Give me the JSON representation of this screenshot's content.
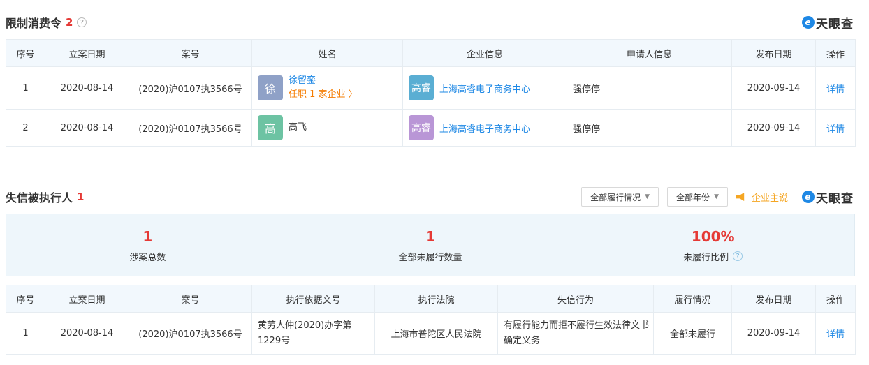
{
  "section1": {
    "title": "限制消费令",
    "count": "2",
    "help_icon": "?",
    "brand": "天眼查",
    "headers": [
      "序号",
      "立案日期",
      "案号",
      "姓名",
      "企业信息",
      "申请人信息",
      "发布日期",
      "操作"
    ],
    "rows": [
      {
        "index": "1",
        "filing_date": "2020-08-14",
        "case_no": "(2020)沪0107执3566号",
        "avatar_char": "徐",
        "avatar_color": "#8fa1c7",
        "name": "徐留銮",
        "role": "任职 1 家企业 〉",
        "company_avatar": "高睿",
        "company_avatar_color": "#5aaed3",
        "company": "上海高睿电子商务中心",
        "applicant": "强停停",
        "publish_date": "2020-09-14",
        "action": "详情"
      },
      {
        "index": "2",
        "filing_date": "2020-08-14",
        "case_no": "(2020)沪0107执3566号",
        "avatar_char": "高",
        "avatar_color": "#6dc3a3",
        "name": "高飞",
        "company_avatar": "高睿",
        "company_avatar_color": "#b996d6",
        "company": "上海高睿电子商务中心",
        "applicant": "强停停",
        "publish_date": "2020-09-14",
        "action": "详情"
      }
    ]
  },
  "section2": {
    "title": "失信被执行人",
    "count": "1",
    "filter_status": "全部履行情况",
    "filter_year": "全部年份",
    "self_say": "企业主说",
    "brand": "天眼查",
    "stats": [
      {
        "value": "1",
        "label": "涉案总数"
      },
      {
        "value": "1",
        "label": "全部未履行数量"
      },
      {
        "value": "100%",
        "label": "未履行比例"
      }
    ],
    "headers": [
      "序号",
      "立案日期",
      "案号",
      "执行依据文号",
      "执行法院",
      "失信行为",
      "履行情况",
      "发布日期",
      "操作"
    ],
    "rows": [
      {
        "index": "1",
        "filing_date": "2020-08-14",
        "case_no": "(2020)沪0107执3566号",
        "basis_no": "黄劳人仲(2020)办字第1229号",
        "court": "上海市普陀区人民法院",
        "behavior": "有履行能力而拒不履行生效法律文书确定义务",
        "status": "全部未履行",
        "publish_date": "2020-09-14",
        "action": "详情"
      }
    ]
  },
  "colors": {
    "accent": "#1e88e5",
    "alert": "#e53935",
    "orange": "#f57c00"
  }
}
